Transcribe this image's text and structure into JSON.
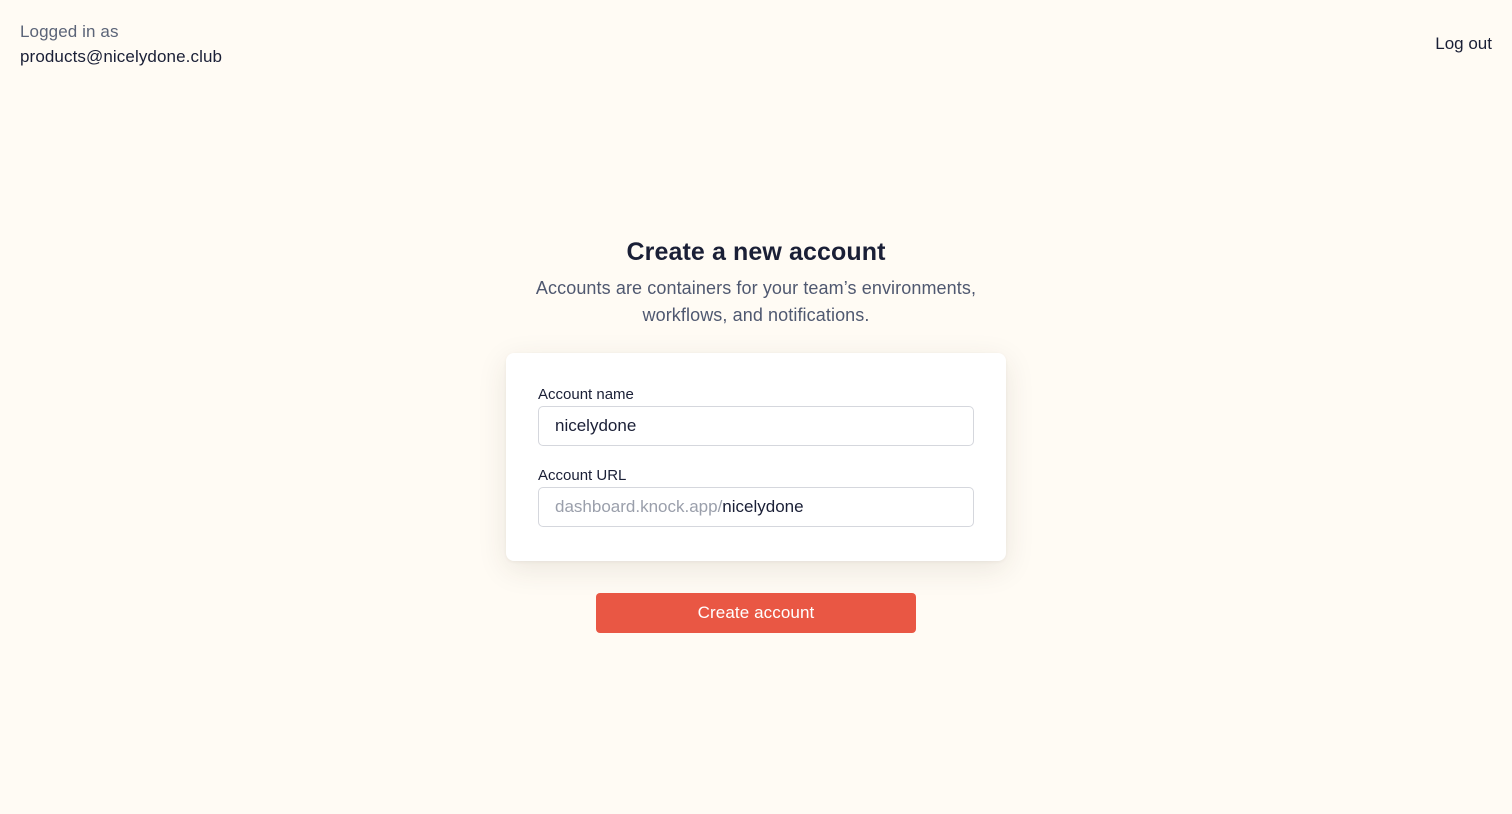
{
  "header": {
    "logged_in_label": "Logged in as",
    "user_email": "products@nicelydone.club",
    "logout_label": "Log out"
  },
  "main": {
    "title": "Create a new account",
    "subtitle": "Accounts are containers for your team’s environments, workflows, and notifications."
  },
  "form": {
    "account_name": {
      "label": "Account name",
      "value": "nicelydone"
    },
    "account_url": {
      "label": "Account URL",
      "prefix": "dashboard.knock.app/",
      "value": "nicelydone"
    },
    "submit_label": "Create account"
  },
  "colors": {
    "background": "#fffbf4",
    "accent": "#e95744"
  }
}
